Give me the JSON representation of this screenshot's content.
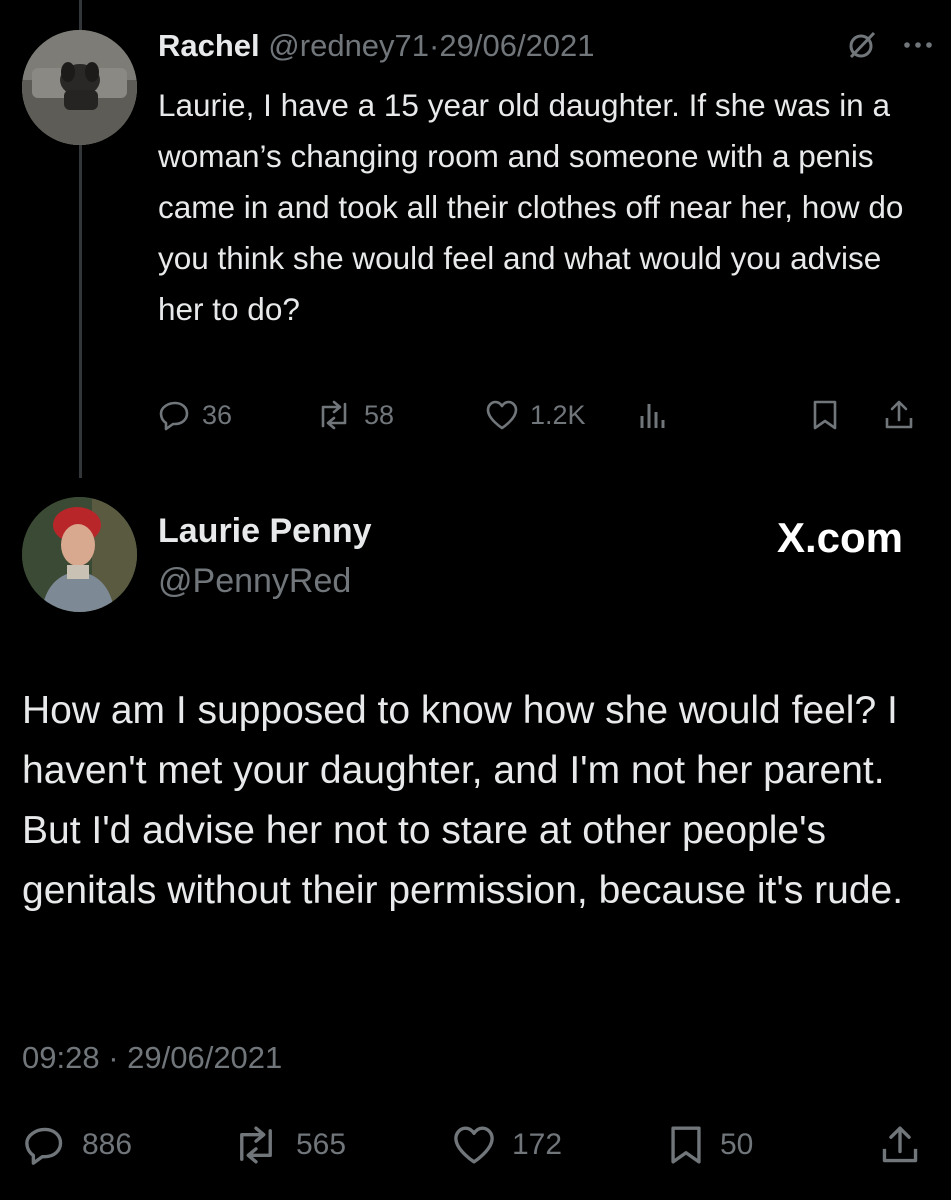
{
  "tweet1": {
    "author_name": "Rachel",
    "handle": "@redney71",
    "separator": "·",
    "date": "29/06/2021",
    "text": "Laurie, I have a 15 year old daughter. If she was in a woman’s changing room and someone with a penis came in  and took all their clothes off near her, how do you think she would feel and what would you advise her to do?",
    "replies": "36",
    "reposts": "58",
    "likes": "1.2K"
  },
  "tweet2": {
    "author_name": "Laurie Penny",
    "handle": "@PennyRed",
    "watermark": "X.com",
    "text": "How am I supposed to know how she would feel? I haven't met your daughter, and I'm not her parent. But I'd advise her not to stare at other people's genitals without their permission, because it's rude.",
    "timestamp": "09:28 · 29/06/2021",
    "replies": "886",
    "reposts": "565",
    "likes": "172",
    "bookmarks": "50"
  },
  "icons": [
    "reply-icon",
    "repost-icon",
    "like-icon",
    "views-icon",
    "bookmark-icon",
    "share-icon",
    "grok-icon",
    "more-icon"
  ],
  "colors": {
    "background": "#000000",
    "text": "#e7e9ea",
    "muted": "#71767b",
    "thread_line": "#333639"
  }
}
